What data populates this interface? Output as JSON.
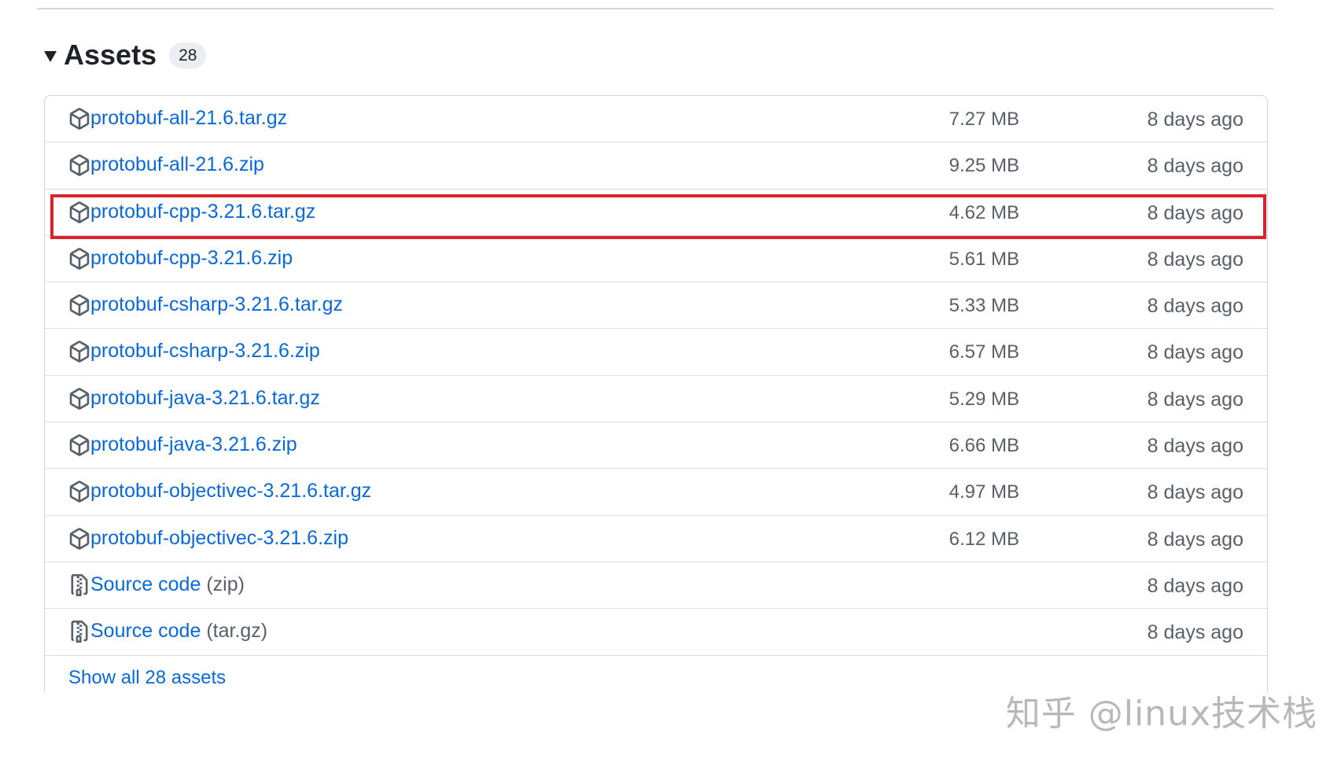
{
  "assets": {
    "title": "Assets",
    "count": "28",
    "show_all_label": "Show all 28 assets",
    "items": [
      {
        "name": "protobuf-all-21.6.tar.gz",
        "suffix": "",
        "icon": "package-icon",
        "size": "7.27 MB",
        "date": "8 days ago"
      },
      {
        "name": "protobuf-all-21.6.zip",
        "suffix": "",
        "icon": "package-icon",
        "size": "9.25 MB",
        "date": "8 days ago"
      },
      {
        "name": "protobuf-cpp-3.21.6.tar.gz",
        "suffix": "",
        "icon": "package-icon",
        "size": "4.62 MB",
        "date": "8 days ago",
        "highlighted": true
      },
      {
        "name": "protobuf-cpp-3.21.6.zip",
        "suffix": "",
        "icon": "package-icon",
        "size": "5.61 MB",
        "date": "8 days ago"
      },
      {
        "name": "protobuf-csharp-3.21.6.tar.gz",
        "suffix": "",
        "icon": "package-icon",
        "size": "5.33 MB",
        "date": "8 days ago"
      },
      {
        "name": "protobuf-csharp-3.21.6.zip",
        "suffix": "",
        "icon": "package-icon",
        "size": "6.57 MB",
        "date": "8 days ago"
      },
      {
        "name": "protobuf-java-3.21.6.tar.gz",
        "suffix": "",
        "icon": "package-icon",
        "size": "5.29 MB",
        "date": "8 days ago"
      },
      {
        "name": "protobuf-java-3.21.6.zip",
        "suffix": "",
        "icon": "package-icon",
        "size": "6.66 MB",
        "date": "8 days ago"
      },
      {
        "name": "protobuf-objectivec-3.21.6.tar.gz",
        "suffix": "",
        "icon": "package-icon",
        "size": "4.97 MB",
        "date": "8 days ago"
      },
      {
        "name": "protobuf-objectivec-3.21.6.zip",
        "suffix": "",
        "icon": "package-icon",
        "size": "6.12 MB",
        "date": "8 days ago"
      },
      {
        "name": "Source code",
        "suffix": "(zip)",
        "icon": "file-zip-icon",
        "size": "",
        "date": "8 days ago"
      },
      {
        "name": "Source code",
        "suffix": "(tar.gz)",
        "icon": "file-zip-icon",
        "size": "",
        "date": "8 days ago"
      }
    ]
  },
  "watermark": "知乎 @linux技术栈",
  "colors": {
    "link": "#0969da",
    "muted": "#57606a",
    "highlight": "#d9232d",
    "border": "#d0d7de"
  }
}
